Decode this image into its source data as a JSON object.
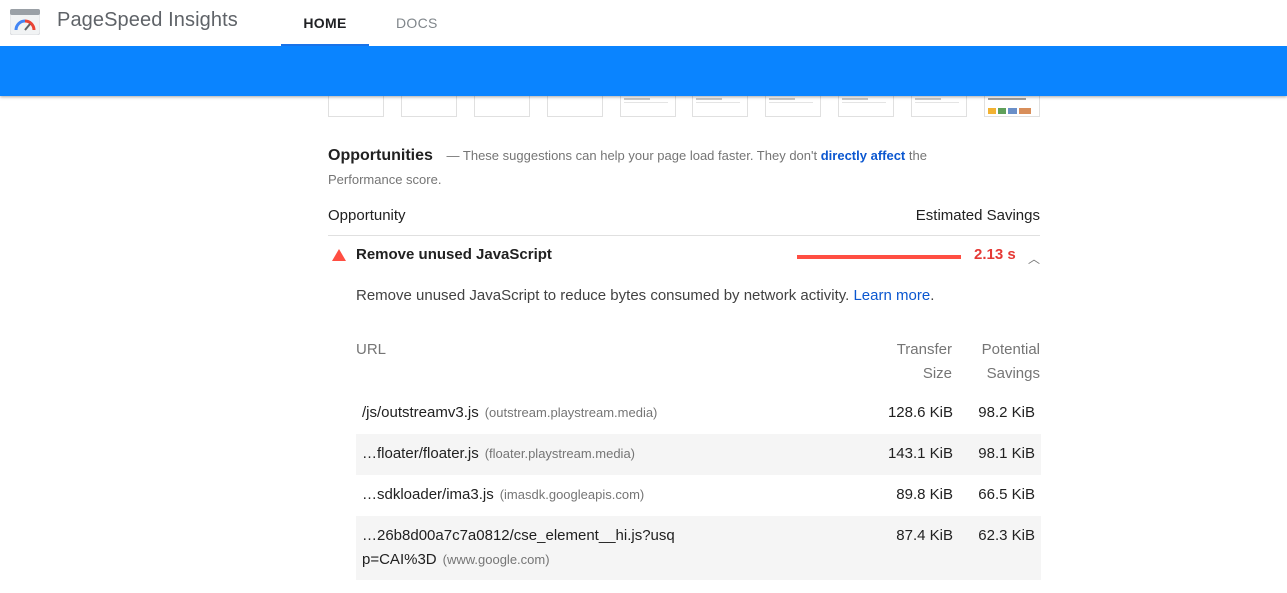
{
  "app": {
    "title": "PageSpeed Insights",
    "logo": "pagespeed-gauge-logo"
  },
  "nav": {
    "tabs": [
      {
        "label": "HOME",
        "active": true
      },
      {
        "label": "DOCS",
        "active": false
      }
    ]
  },
  "colors": {
    "accent_bar": "#0a84ff",
    "fail": "#ff4e42",
    "link": "#0b57d0"
  },
  "opportunities": {
    "title": "Opportunities",
    "dash": "—",
    "desc_before": "These suggestions can help your page load faster. They don't",
    "desc_link": "directly affect",
    "desc_after": "the Performance score.",
    "col_left": "Opportunity",
    "col_right": "Estimated Savings"
  },
  "audit": {
    "icon": "fail-triangle-icon",
    "title": "Remove unused JavaScript",
    "savings": "2.13 s",
    "chevron": "chevron-up-icon",
    "description": "Remove unused JavaScript to reduce bytes consumed by network activity.",
    "learn_more": "Learn more",
    "period": "."
  },
  "table": {
    "headers": {
      "url": "URL",
      "transfer_size": "Transfer Size",
      "potential_savings": "Potential Savings"
    },
    "rows": [
      {
        "path": "/js/outstreamv3.js",
        "host": "(outstream.playstream.media)",
        "size": "128.6 KiB",
        "savings": "98.2 KiB"
      },
      {
        "path": "…floater/floater.js",
        "host": "(floater.playstream.media)",
        "size": "143.1 KiB",
        "savings": "98.1 KiB"
      },
      {
        "path": "…sdkloader/ima3.js",
        "host": "(imasdk.googleapis.com)",
        "size": "89.8 KiB",
        "savings": "66.5 KiB"
      },
      {
        "path": "…26b8d00a7c7a0812/cse_element__hi.js?usqp=CAI%3D",
        "host": "(www.google.com)",
        "size": "87.4 KiB",
        "savings": "62.3 KiB"
      }
    ]
  }
}
